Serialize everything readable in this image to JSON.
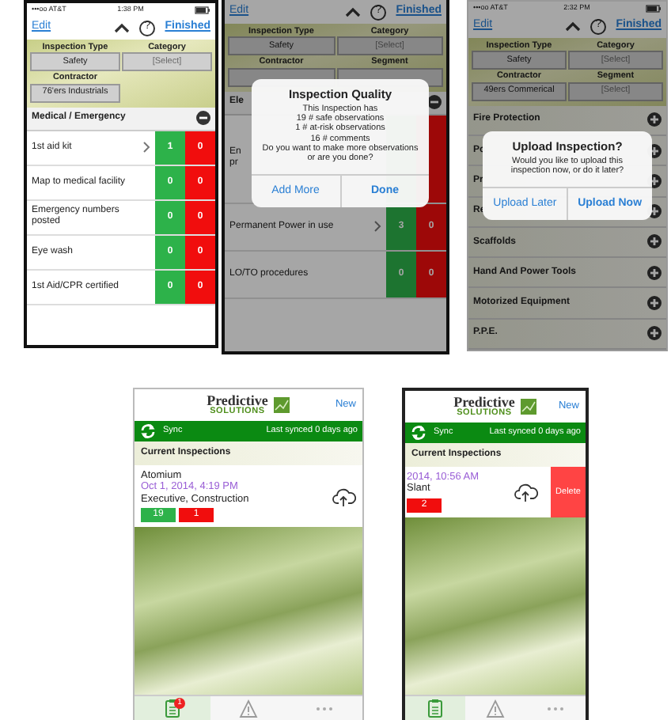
{
  "top_row": [
    {
      "kind": "inspection",
      "status_bar": {
        "carrier": "•••oo AT&T",
        "time": "1:38 PM"
      },
      "nav": {
        "left": "Edit",
        "help": "?",
        "right": "Finished"
      },
      "fields": [
        {
          "label": "Inspection Type",
          "value": "Safety"
        },
        {
          "label": "Category",
          "placeholder": "[Select]"
        },
        {
          "label": "Contractor",
          "value": "76'ers Industrials"
        }
      ],
      "sections": [
        {
          "title": "Medical / Emergency",
          "expanded": true,
          "rows": [
            {
              "label": "1st aid kit",
              "chevron": true,
              "safe": "1",
              "at_risk": "0"
            },
            {
              "label": "Map to medical facility",
              "chevron": false,
              "safe": "0",
              "at_risk": "0"
            },
            {
              "label": "Emergency numbers posted",
              "chevron": false,
              "safe": "0",
              "at_risk": "0"
            },
            {
              "label": "Eye wash",
              "chevron": false,
              "safe": "0",
              "at_risk": "0"
            },
            {
              "label": "1st Aid/CPR certified",
              "chevron": false,
              "safe": "0",
              "at_risk": "0"
            }
          ]
        }
      ]
    },
    {
      "kind": "inspection",
      "nav": {
        "left": "Edit",
        "help": "?",
        "right": "Finished"
      },
      "fields": [
        {
          "label": "Inspection Type",
          "value": "Safety"
        },
        {
          "label": "Category",
          "placeholder": "[Select]"
        },
        {
          "label": "Contractor"
        },
        {
          "label": "Segment"
        }
      ],
      "sections": [
        {
          "title": "Ele",
          "expanded": true,
          "rows": [
            {
              "label": "En pr",
              "chevron": false
            },
            {
              "label": "Permanent Power in use",
              "chevron": true,
              "safe": "3",
              "at_risk": "0"
            },
            {
              "label": "LO/TO procedures",
              "chevron": false,
              "safe": "0",
              "at_risk": "0"
            }
          ]
        }
      ],
      "dialog": {
        "title": "Inspection Quality",
        "lines": [
          "This Inspection has",
          "19 # safe observations",
          "1 # at-risk observations",
          "16 # comments",
          "Do you want to make more observations or are you done?"
        ],
        "buttons": [
          {
            "label": "Add More",
            "primary": false
          },
          {
            "label": "Done",
            "primary": true
          }
        ]
      }
    },
    {
      "kind": "inspection",
      "status_bar": {
        "carrier": "•••oo AT&T",
        "time": "2:32 PM"
      },
      "nav": {
        "left": "Edit",
        "help": "?",
        "right": "Finished"
      },
      "fields": [
        {
          "label": "Inspection Type",
          "value": "Safety"
        },
        {
          "label": "Category",
          "placeholder": "[Select]"
        },
        {
          "label": "Contractor",
          "value": "49ers Commerical"
        },
        {
          "label": "Segment",
          "placeholder": "[Select]"
        }
      ],
      "sections": [
        {
          "title": "Fire Protection",
          "expanded": false
        },
        {
          "title": "Po",
          "expanded": false
        },
        {
          "title": "Pr",
          "expanded": false
        },
        {
          "title": "Re",
          "expanded": false
        },
        {
          "title": "Scaffolds",
          "expanded": false
        },
        {
          "title": "Hand And Power Tools",
          "expanded": false
        },
        {
          "title": "Motorized Equipment",
          "expanded": false
        },
        {
          "title": "P.P.E.",
          "expanded": false
        }
      ],
      "dialog": {
        "title": "Upload Inspection?",
        "lines": [
          "Would you like to upload this inspection now, or do it later?"
        ],
        "buttons": [
          {
            "label": "Upload Later",
            "primary": false
          },
          {
            "label": "Upload Now",
            "primary": true
          }
        ]
      }
    }
  ],
  "bottom_row": [
    {
      "kind": "list",
      "logo": {
        "top": "Predictive",
        "bottom": "SOLUTIONS"
      },
      "new": "New",
      "sync": {
        "label": "Sync",
        "last": "Last synced 0 days ago"
      },
      "heading": "Current Inspections",
      "cards": [
        {
          "name": "Atomium",
          "date": "Oct 1, 2014, 4:19 PM",
          "tags": "Executive, Construction",
          "safe": "19",
          "at_risk": "1",
          "swiped": false
        }
      ],
      "tabs": [
        {
          "kind": "clipboard",
          "badge": "1",
          "selected": true
        },
        {
          "kind": "warning",
          "selected": false
        },
        {
          "kind": "more",
          "selected": false
        }
      ]
    },
    {
      "kind": "list",
      "logo": {
        "top": "Predictive",
        "bottom": "SOLUTIONS"
      },
      "new": "New",
      "sync": {
        "label": "Sync",
        "last": "Last synced 0 days ago"
      },
      "heading": "Current Inspections",
      "cards": [
        {
          "date": "2014, 10:56 AM",
          "tags": "Slant",
          "at_risk": "2",
          "swiped": true,
          "action": "Delete"
        }
      ],
      "tabs": [
        {
          "kind": "clipboard",
          "selected": true
        },
        {
          "kind": "warning",
          "selected": false
        },
        {
          "kind": "more",
          "selected": false
        }
      ]
    }
  ]
}
